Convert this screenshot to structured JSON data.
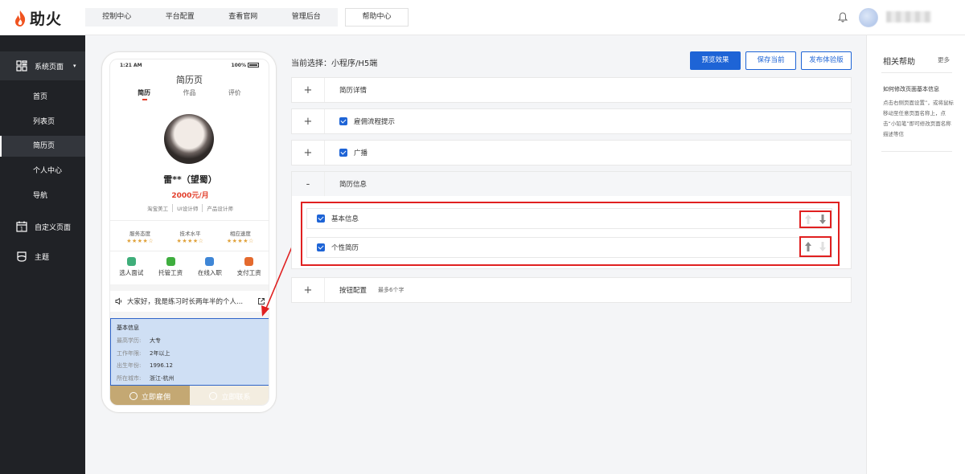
{
  "brand": {
    "name": "助火"
  },
  "topnav": {
    "items": [
      "控制中心",
      "平台配置",
      "查看官网",
      "管理后台"
    ],
    "help_center": "帮助中心"
  },
  "sidebar": {
    "group_label": "系统页面",
    "sub_items": [
      "首页",
      "列表页",
      "简历页",
      "个人中心",
      "导航"
    ],
    "active_sub": "简历页",
    "custom_page": "自定义页面",
    "theme": "主题"
  },
  "phone": {
    "time": "1:21 AM",
    "battery": "100%",
    "page_title": "简历页",
    "tabs": [
      "简历",
      "作品",
      "评价"
    ],
    "name": "雷**（望蜀）",
    "salary": "2000元/月",
    "tags": [
      "淘宝美工",
      "UI设计师",
      "产品设计师"
    ],
    "ratings": [
      {
        "label": "服务态度",
        "stars": "★★★★☆"
      },
      {
        "label": "技术水平",
        "stars": "★★★★☆"
      },
      {
        "label": "相应速度",
        "stars": "★★★★☆"
      }
    ],
    "actions": [
      {
        "label": "选人面试",
        "color": "#3fae7a"
      },
      {
        "label": "托管工资",
        "color": "#3fae3f"
      },
      {
        "label": "在线入职",
        "color": "#3f86d6"
      },
      {
        "label": "支付工资",
        "color": "#e46a2e"
      }
    ],
    "intro": "大家好，我是练习时长两年半的个人...",
    "basic_info": {
      "title": "基本信息",
      "rows": [
        {
          "k": "最高学历:",
          "v": "大专"
        },
        {
          "k": "工作年限:",
          "v": "2年以上"
        },
        {
          "k": "出生年份:",
          "v": "1996.12"
        },
        {
          "k": "所在城市:",
          "v": "浙江-杭州"
        }
      ]
    },
    "hire_button": "立即雇佣",
    "contact_button": "立即联系"
  },
  "main": {
    "current_select": "当前选择：小程序/H5端",
    "preview_button": "预览效果",
    "save_button": "保存当前",
    "publish_button": "发布体验版",
    "sections": [
      {
        "sign": "+",
        "label": "简历详情",
        "checked": false
      },
      {
        "sign": "+",
        "label": "雇佣流程提示",
        "checked": true
      },
      {
        "sign": "+",
        "label": "广播",
        "checked": true
      },
      {
        "sign": "-",
        "label": "简历信息",
        "checked": false
      },
      {
        "sign": "+",
        "label": "按钮配置",
        "checked": false,
        "note": "最多6个字"
      }
    ],
    "sub_rows": [
      {
        "label": "基本信息"
      },
      {
        "label": "个性简历"
      }
    ]
  },
  "help_panel": {
    "title": "相关帮助",
    "more": "更多",
    "question": "如何修改页面基本信息",
    "answer": "点击右侧页面设置”，或将鼠标移动至任意页面名称上，点击“小铅笔”即可修改页面名称描述等信"
  }
}
